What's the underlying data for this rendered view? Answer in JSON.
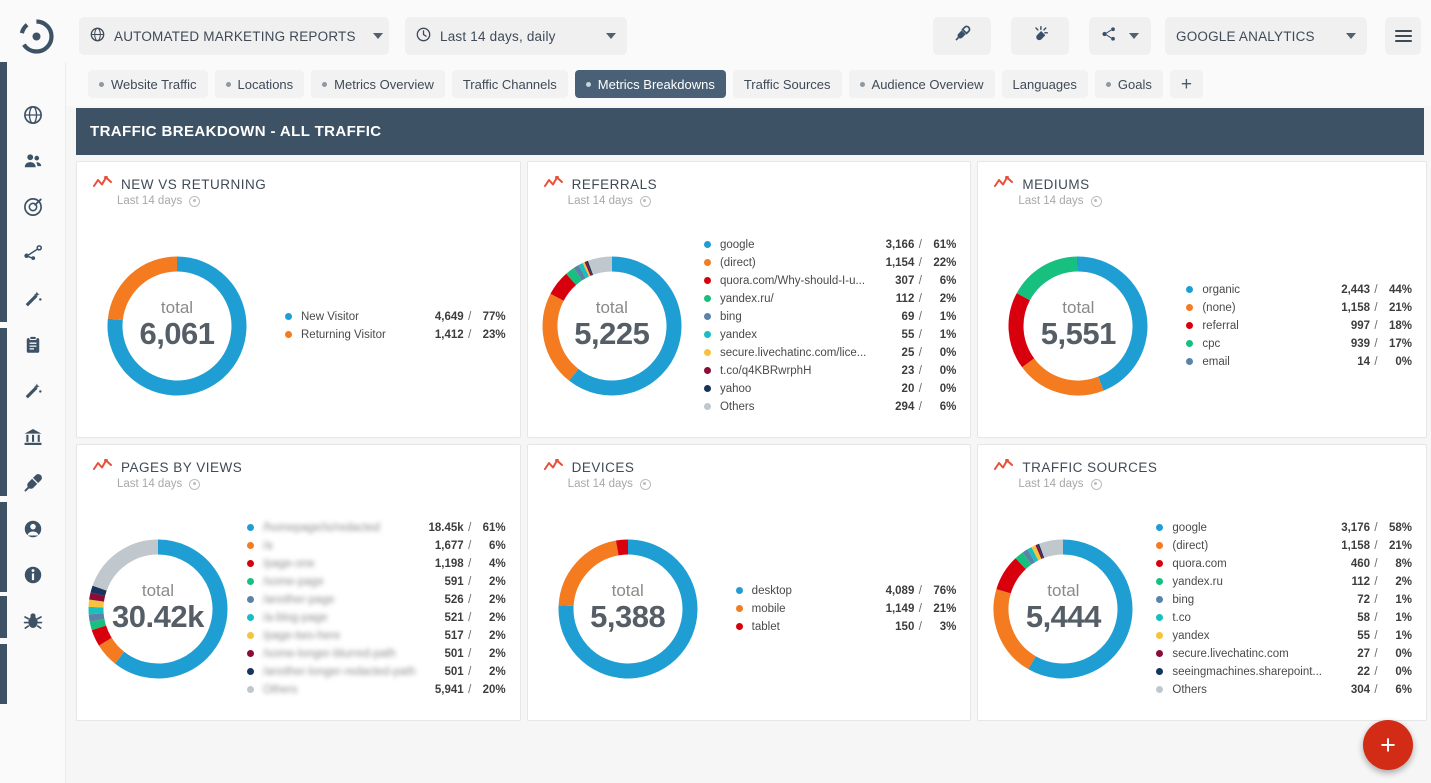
{
  "topbar": {
    "logo_icon": "target-logo-icon",
    "project": {
      "label": "AUTOMATED MARKETING REPORTS",
      "icon": "globe-icon"
    },
    "daterange": {
      "label": "Last 14 days, daily",
      "icon": "clock-icon"
    },
    "connect_button": {
      "icon": "plug-icon"
    },
    "disconnect_button": {
      "icon": "plug-disconnect-icon"
    },
    "share_button": {
      "icon": "share-icon"
    },
    "datasource": {
      "label": "GOOGLE ANALYTICS"
    },
    "hamburger": {
      "icon": "hamburger-menu-icon"
    }
  },
  "tabs": [
    {
      "label": "Website Traffic",
      "dot": true,
      "active": false
    },
    {
      "label": "Locations",
      "dot": true,
      "active": false
    },
    {
      "label": "Metrics Overview",
      "dot": true,
      "active": false
    },
    {
      "label": "Traffic Channels",
      "dot": false,
      "active": false
    },
    {
      "label": "Metrics Breakdowns",
      "dot": true,
      "active": true
    },
    {
      "label": "Traffic Sources",
      "dot": false,
      "active": false
    },
    {
      "label": "Audience Overview",
      "dot": true,
      "active": false
    },
    {
      "label": "Languages",
      "dot": false,
      "active": false
    },
    {
      "label": "Goals",
      "dot": true,
      "active": false
    }
  ],
  "add_tab_label": "+",
  "rail_icons": [
    "globe-icon",
    "users-icon",
    "target-globe-icon",
    "network-icon",
    "wand-icon",
    "clipboard-icon",
    "wand-alt-icon",
    "bank-icon",
    "plug-icon",
    "account-icon",
    "info-icon",
    "bug-icon"
  ],
  "section": {
    "title": "TRAFFIC BREAKDOWN - ALL TRAFFIC",
    "accent": "#3e5266"
  },
  "fab": {
    "label": "+",
    "color": "#d32c16"
  },
  "palette": {
    "blue": "#1f9ed4",
    "orange": "#f47b20",
    "red": "#d9000d",
    "green": "#17c07e",
    "steel": "#5b83a8",
    "teal": "#18bec0",
    "yellow": "#f6c33c",
    "maroon": "#8c0b3a",
    "navy": "#17355c",
    "grey": "#c0c7cd"
  },
  "chart_data": [
    {
      "type": "pie",
      "title": "NEW VS RETURNING",
      "subtitle": "Last 14 days",
      "total_label": "total",
      "total": "6,061",
      "categories": [
        "New Visitor",
        "Returning Visitor"
      ],
      "values": [
        "4,649",
        "1,412"
      ],
      "percents": [
        "77%",
        "23%"
      ],
      "numeric": [
        4649,
        1412
      ],
      "colors": [
        "#1f9ed4",
        "#f47b20"
      ]
    },
    {
      "type": "pie",
      "title": "REFERRALS",
      "subtitle": "Last 14 days",
      "total_label": "total",
      "total": "5,225",
      "categories": [
        "google",
        "(direct)",
        "quora.com/Why-should-I-u...",
        "yandex.ru/",
        "bing",
        "yandex",
        "secure.livechatinc.com/lice...",
        "t.co/q4KBRwrphH",
        "yahoo",
        "Others"
      ],
      "values": [
        "3,166",
        "1,154",
        "307",
        "112",
        "69",
        "55",
        "25",
        "23",
        "20",
        "294"
      ],
      "percents": [
        "61%",
        "22%",
        "6%",
        "2%",
        "1%",
        "1%",
        "0%",
        "0%",
        "0%",
        "6%"
      ],
      "numeric": [
        3166,
        1154,
        307,
        112,
        69,
        55,
        25,
        23,
        20,
        294
      ],
      "colors": [
        "#1f9ed4",
        "#f47b20",
        "#d9000d",
        "#17c07e",
        "#5b83a8",
        "#18bec0",
        "#f6c33c",
        "#8c0b3a",
        "#17355c",
        "#c0c7cd"
      ]
    },
    {
      "type": "pie",
      "title": "MEDIUMS",
      "subtitle": "Last 14 days",
      "total_label": "total",
      "total": "5,551",
      "categories": [
        "organic",
        "(none)",
        "referral",
        "cpc",
        "email"
      ],
      "values": [
        "2,443",
        "1,158",
        "997",
        "939",
        "14"
      ],
      "percents": [
        "44%",
        "21%",
        "18%",
        "17%",
        "0%"
      ],
      "numeric": [
        2443,
        1158,
        997,
        939,
        14
      ],
      "colors": [
        "#1f9ed4",
        "#f47b20",
        "#d9000d",
        "#17c07e",
        "#5b83a8"
      ]
    },
    {
      "type": "pie",
      "title": "PAGES BY VIEWS",
      "subtitle": "Last 14 days",
      "total_label": "total",
      "total": "30.42k",
      "blurred_labels": true,
      "categories": [
        "/homepage/is/redacted",
        "/a",
        "/page-one",
        "/some-page",
        "/another-page",
        "/a-blog-page",
        "/page-two-here",
        "/some-longer-blurred-path",
        "/another-longer-redacted-path",
        "Others"
      ],
      "values": [
        "18.45k",
        "1,677",
        "1,198",
        "591",
        "526",
        "521",
        "517",
        "501",
        "501",
        "5,941"
      ],
      "percents": [
        "61%",
        "6%",
        "4%",
        "2%",
        "2%",
        "2%",
        "2%",
        "2%",
        "2%",
        "20%"
      ],
      "numeric": [
        18450,
        1677,
        1198,
        591,
        526,
        521,
        517,
        501,
        501,
        5941
      ],
      "colors": [
        "#1f9ed4",
        "#f47b20",
        "#d9000d",
        "#17c07e",
        "#5b83a8",
        "#18bec0",
        "#f6c33c",
        "#8c0b3a",
        "#17355c",
        "#c0c7cd"
      ]
    },
    {
      "type": "pie",
      "title": "DEVICES",
      "subtitle": "Last 14 days",
      "total_label": "total",
      "total": "5,388",
      "categories": [
        "desktop",
        "mobile",
        "tablet"
      ],
      "values": [
        "4,089",
        "1,149",
        "150"
      ],
      "percents": [
        "76%",
        "21%",
        "3%"
      ],
      "numeric": [
        4089,
        1149,
        150
      ],
      "colors": [
        "#1f9ed4",
        "#f47b20",
        "#d9000d"
      ]
    },
    {
      "type": "pie",
      "title": "TRAFFIC SOURCES",
      "subtitle": "Last 14 days",
      "total_label": "total",
      "total": "5,444",
      "categories": [
        "google",
        "(direct)",
        "quora.com",
        "yandex.ru",
        "bing",
        "t.co",
        "yandex",
        "secure.livechatinc.com",
        "seeingmachines.sharepoint...",
        "Others"
      ],
      "values": [
        "3,176",
        "1,158",
        "460",
        "112",
        "72",
        "58",
        "55",
        "27",
        "22",
        "304"
      ],
      "percents": [
        "58%",
        "21%",
        "8%",
        "2%",
        "1%",
        "1%",
        "1%",
        "0%",
        "0%",
        "6%"
      ],
      "numeric": [
        3176,
        1158,
        460,
        112,
        72,
        58,
        55,
        27,
        22,
        304
      ],
      "colors": [
        "#1f9ed4",
        "#f47b20",
        "#d9000d",
        "#17c07e",
        "#5b83a8",
        "#18bec0",
        "#f6c33c",
        "#8c0b3a",
        "#17355c",
        "#c0c7cd"
      ]
    }
  ]
}
